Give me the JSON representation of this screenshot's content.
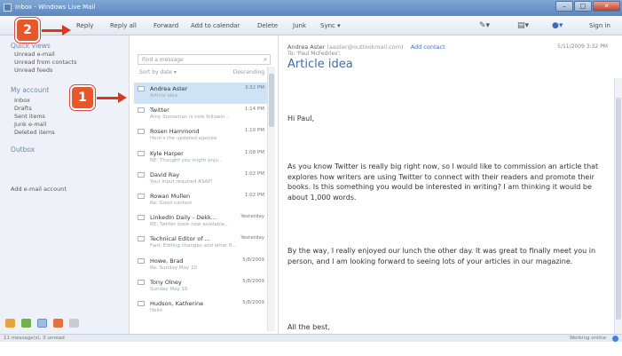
{
  "window": {
    "title": "Inbox - Windows Live Mail",
    "minimize": "–",
    "maximize": "□",
    "close": "✕"
  },
  "toolbar": {
    "reply": "Reply",
    "reply_all": "Reply all",
    "forward": "Forward",
    "add_to_calendar": "Add to calendar",
    "delete": "Delete",
    "junk": "Junk",
    "sync": "Sync ▾",
    "sign_in": "Sign in",
    "compose_icon": "pen-icon",
    "views_icon": "views-icon",
    "menu_icon": "gear-icon"
  },
  "callouts": {
    "step1": "1",
    "step2": "2",
    "color": "#e8572a"
  },
  "sidebar": {
    "quick_views_title": "Quick views",
    "quick_views": [
      "Unread e-mail",
      "Unread from contacts",
      "Unread feeds"
    ],
    "account_title": "My account",
    "folders": [
      "Inbox",
      "Drafts",
      "Sent items",
      "Junk e-mail",
      "Deleted items"
    ],
    "outbox": "Outbox",
    "add_account": "Add e-mail account",
    "bottom_icons": [
      "mail-icon",
      "calendar-icon",
      "contacts-icon",
      "feeds-icon",
      "newsgroups-icon"
    ]
  },
  "message_list": {
    "search_placeholder": "Find a message",
    "sort_by": "Sort by date ▾",
    "order": "Descending ⇩",
    "messages": [
      {
        "sender": "Andrea Aster",
        "time": "3:32 PM",
        "preview": "Article idea",
        "selected": true
      },
      {
        "sender": "Twitter",
        "time": "1:14 PM",
        "preview": "Amy Stoneman is now followin...",
        "selected": false
      },
      {
        "sender": "Rosen Hammond",
        "time": "1:10 PM",
        "preview": "Here's the updated agenda",
        "selected": false
      },
      {
        "sender": "Kyle Harper",
        "time": "1:08 PM",
        "preview": "RE: Thought you might enjo...",
        "selected": false
      },
      {
        "sender": "David Ray",
        "time": "1:02 PM",
        "preview": "Your input required ASAP!",
        "selected": false
      },
      {
        "sender": "Rowan Mullen",
        "time": "1:02 PM",
        "preview": "Re: Good contest",
        "selected": false
      },
      {
        "sender": "LinkedIn Daily - Dekk...",
        "time": "Yesterday",
        "preview": "RE: Twitter book now available...",
        "selected": false
      },
      {
        "sender": "Technical Editor of ...",
        "time": "Yesterday",
        "preview": "Fwd: Editing changes and other fl...",
        "selected": false
      },
      {
        "sender": "Howe, Brad",
        "time": "5/8/2009",
        "preview": "Re: Sunday May 10",
        "selected": false
      },
      {
        "sender": "Tony Olney",
        "time": "5/8/2009",
        "preview": "Sunday May 10",
        "selected": false
      },
      {
        "sender": "Hudson, Katherine",
        "time": "5/8/2009",
        "preview": "Hello",
        "selected": false
      }
    ]
  },
  "reading_pane": {
    "from_name": "Andrea Aster",
    "from_addr": "(aaster@outlookmail.com)",
    "add_contact": "Add contact",
    "date": "5/11/2009 3:32 PM",
    "to": "To: 'Paul McFedries';",
    "subject": "Article idea",
    "greeting": "Hi Paul,",
    "para1": "As you know Twitter is really big right now, so I would like to commission an article that explores how writers are using Twitter to connect with their readers and promote their books. Is this something you would be interested in writing? I am thinking it would be about 1,000 words.",
    "para2": "By the way, I really enjoyed our lunch the other day. It was great to finally meet you in person, and I am looking forward to seeing lots of your articles in our magazine.",
    "closing": "All the best,"
  },
  "status": {
    "left": "11 message(s), 3 unread",
    "right": "Working online"
  }
}
